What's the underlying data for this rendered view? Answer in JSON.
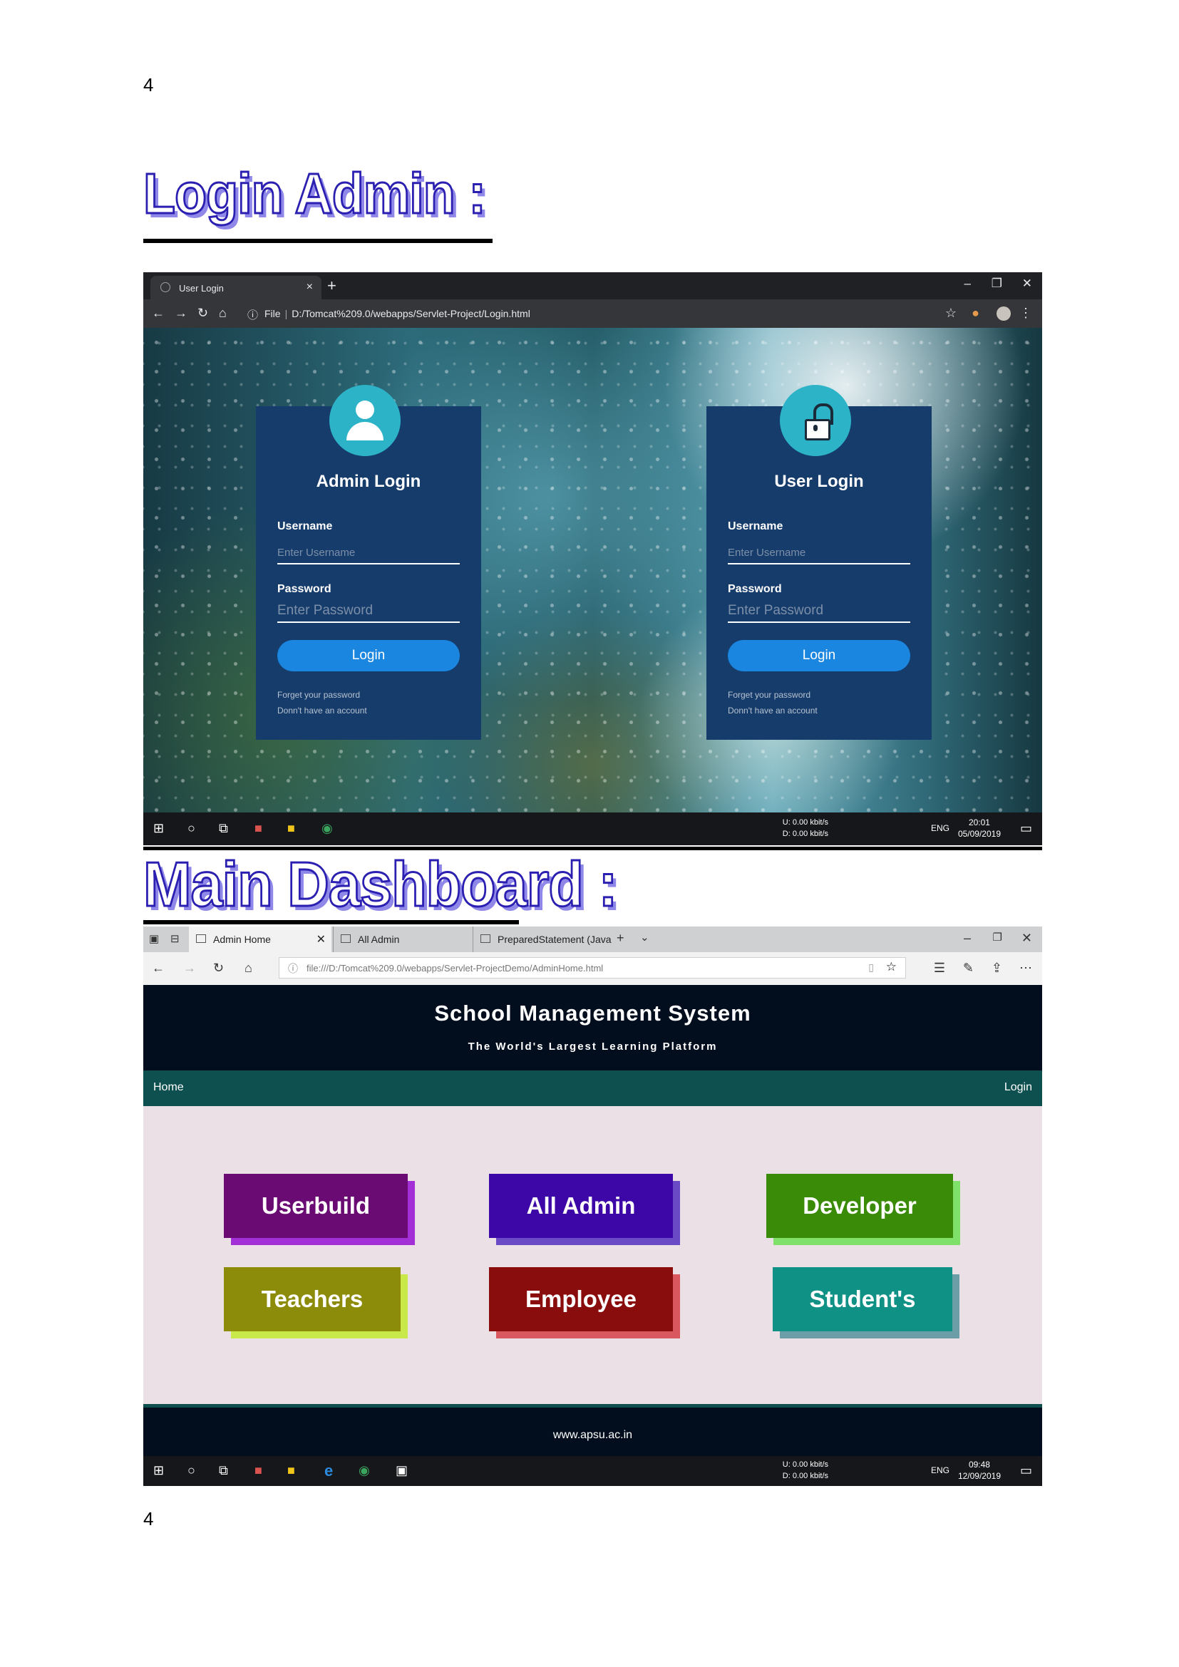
{
  "page_number": "4",
  "section1": {
    "title": "Login Admin :"
  },
  "section2": {
    "title": "Main Dashboard :"
  },
  "shot1": {
    "tab_title": "User Login",
    "new_tab": "+",
    "window_controls": [
      "–",
      "❐",
      "✕"
    ],
    "address": {
      "scheme_label": "File",
      "url": "D:/Tomcat%209.0/webapps/Servlet-Project/Login.html"
    },
    "admin_card": {
      "title": "Admin Login",
      "username_label": "Username",
      "username_placeholder": "Enter Username",
      "password_label": "Password",
      "password_placeholder": "Enter Password",
      "button": "Login",
      "link_forgot": "Forget your password",
      "link_account": "Donn't have an account",
      "icon": "user-icon"
    },
    "user_card": {
      "title": "User Login",
      "username_label": "Username",
      "username_placeholder": "Enter Username",
      "password_label": "Password",
      "password_placeholder": "Enter Password",
      "button": "Login",
      "link_forgot": "Forget your password",
      "link_account": "Donn't have an account",
      "icon": "unlock-icon"
    },
    "taskbar": {
      "net_up": "0.00 kbit/s",
      "net_down": "0.00 kbit/s",
      "net_u": "U:",
      "net_d": "D:",
      "lang": "ENG",
      "time": "20:01",
      "date": "05/09/2019"
    }
  },
  "shot2": {
    "tabs": [
      "Admin Home",
      "All Admin",
      "PreparedStatement (Java Pl"
    ],
    "address": "file:///D:/Tomcat%209.0/webapps/Servlet-ProjectDemo/AdminHome.html",
    "site_title": "School Management System",
    "site_subtitle": "The World's Largest Learning Platform",
    "nav_home": "Home",
    "nav_login": "Login",
    "tiles": [
      {
        "label": "Userbuild",
        "color": "#6a0b73",
        "shadow": "#a32fd6"
      },
      {
        "label": "All Admin",
        "color": "#3d07a8",
        "shadow": "#6a4ac5"
      },
      {
        "label": "Developer",
        "color": "#3a8b08",
        "shadow": "#7fe06a"
      },
      {
        "label": "Teachers",
        "color": "#8c8c0a",
        "shadow": "#c9e84a"
      },
      {
        "label": "Employee",
        "color": "#8a0d0d",
        "shadow": "#d9575e"
      },
      {
        "label": "Student's",
        "color": "#0f9186",
        "shadow": "#6b9ea6"
      }
    ],
    "footer": "www.apsu.ac.in",
    "taskbar": {
      "net_up": "0.00 kbit/s",
      "net_down": "0.00 kbit/s",
      "net_u": "U:",
      "net_d": "D:",
      "lang": "ENG",
      "time": "09:48",
      "date": "12/09/2019"
    }
  }
}
